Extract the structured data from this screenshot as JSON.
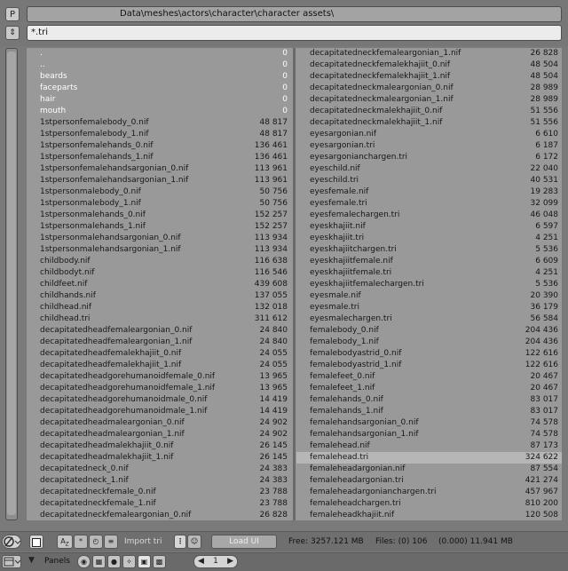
{
  "header": {
    "p_button_label": "P",
    "path": "Data\\meshes\\actors\\character\\character assets\\",
    "sort_button_label": "⇕",
    "filter": "*.tri"
  },
  "left_column": [
    {
      "name": ".",
      "size": "0",
      "type": "dir"
    },
    {
      "name": "..",
      "size": "0",
      "type": "dir"
    },
    {
      "name": "beards",
      "size": "0",
      "type": "dir"
    },
    {
      "name": "faceparts",
      "size": "0",
      "type": "dir"
    },
    {
      "name": "hair",
      "size": "0",
      "type": "dir"
    },
    {
      "name": "mouth",
      "size": "0",
      "type": "dir"
    },
    {
      "name": "1stpersonfemalebody_0.nif",
      "size": "48 817",
      "type": "file"
    },
    {
      "name": "1stpersonfemalebody_1.nif",
      "size": "48 817",
      "type": "file"
    },
    {
      "name": "1stpersonfemalehands_0.nif",
      "size": "136 461",
      "type": "file"
    },
    {
      "name": "1stpersonfemalehands_1.nif",
      "size": "136 461",
      "type": "file"
    },
    {
      "name": "1stpersonfemalehandsargonian_0.nif",
      "size": "113 961",
      "type": "file"
    },
    {
      "name": "1stpersonfemalehandsargonian_1.nif",
      "size": "113 961",
      "type": "file"
    },
    {
      "name": "1stpersonmalebody_0.nif",
      "size": "50 756",
      "type": "file"
    },
    {
      "name": "1stpersonmalebody_1.nif",
      "size": "50 756",
      "type": "file"
    },
    {
      "name": "1stpersonmalehands_0.nif",
      "size": "152 257",
      "type": "file"
    },
    {
      "name": "1stpersonmalehands_1.nif",
      "size": "152 257",
      "type": "file"
    },
    {
      "name": "1stpersonmalehandsargonian_0.nif",
      "size": "113 934",
      "type": "file"
    },
    {
      "name": "1stpersonmalehandsargonian_1.nif",
      "size": "113 934",
      "type": "file"
    },
    {
      "name": "childbody.nif",
      "size": "116 638",
      "type": "file"
    },
    {
      "name": "childbodyt.nif",
      "size": "116 546",
      "type": "file"
    },
    {
      "name": "childfeet.nif",
      "size": "439 608",
      "type": "file"
    },
    {
      "name": "childhands.nif",
      "size": "137 055",
      "type": "file"
    },
    {
      "name": "childhead.nif",
      "size": "132 018",
      "type": "file"
    },
    {
      "name": "childhead.tri",
      "size": "311 612",
      "type": "file"
    },
    {
      "name": "decapitatedheadfemaleargonian_0.nif",
      "size": "24 840",
      "type": "file"
    },
    {
      "name": "decapitatedheadfemaleargonian_1.nif",
      "size": "24 840",
      "type": "file"
    },
    {
      "name": "decapitatedheadfemalekhajiit_0.nif",
      "size": "24 055",
      "type": "file"
    },
    {
      "name": "decapitatedheadfemalekhajiit_1.nif",
      "size": "24 055",
      "type": "file"
    },
    {
      "name": "decapitatedheadgorehumanoidfemale_0.nif",
      "size": "13 965",
      "type": "file"
    },
    {
      "name": "decapitatedheadgorehumanoidfemale_1.nif",
      "size": "13 965",
      "type": "file"
    },
    {
      "name": "decapitatedheadgorehumanoidmale_0.nif",
      "size": "14 419",
      "type": "file"
    },
    {
      "name": "decapitatedheadgorehumanoidmale_1.nif",
      "size": "14 419",
      "type": "file"
    },
    {
      "name": "decapitatedheadmaleargonian_0.nif",
      "size": "24 902",
      "type": "file"
    },
    {
      "name": "decapitatedheadmaleargonian_1.nif",
      "size": "24 902",
      "type": "file"
    },
    {
      "name": "decapitatedheadmalekhajiit_0.nif",
      "size": "26 145",
      "type": "file"
    },
    {
      "name": "decapitatedheadmalekhajiit_1.nif",
      "size": "26 145",
      "type": "file"
    },
    {
      "name": "decapitatedneck_0.nif",
      "size": "24 383",
      "type": "file"
    },
    {
      "name": "decapitatedneck_1.nif",
      "size": "24 383",
      "type": "file"
    },
    {
      "name": "decapitatedneckfemale_0.nif",
      "size": "23 788",
      "type": "file"
    },
    {
      "name": "decapitatedneckfemale_1.nif",
      "size": "23 788",
      "type": "file"
    },
    {
      "name": "decapitatedneckfemaleargonian_0.nif",
      "size": "26 828",
      "type": "file"
    }
  ],
  "right_column": [
    {
      "name": "decapitatedneckfemaleargonian_1.nif",
      "size": "26 828",
      "type": "file"
    },
    {
      "name": "decapitatedneckfemalekhajiit_0.nif",
      "size": "48 504",
      "type": "file"
    },
    {
      "name": "decapitatedneckfemalekhajiit_1.nif",
      "size": "48 504",
      "type": "file"
    },
    {
      "name": "decapitatedneckmaleargonian_0.nif",
      "size": "28 989",
      "type": "file"
    },
    {
      "name": "decapitatedneckmaleargonian_1.nif",
      "size": "28 989",
      "type": "file"
    },
    {
      "name": "decapitatedneckmalekhajiit_0.nif",
      "size": "51 556",
      "type": "file"
    },
    {
      "name": "decapitatedneckmalekhajiit_1.nif",
      "size": "51 556",
      "type": "file"
    },
    {
      "name": "eyesargonian.nif",
      "size": "6 610",
      "type": "file"
    },
    {
      "name": "eyesargonian.tri",
      "size": "6 187",
      "type": "file"
    },
    {
      "name": "eyesargonianchargen.tri",
      "size": "6 172",
      "type": "file"
    },
    {
      "name": "eyeschild.nif",
      "size": "22 040",
      "type": "file"
    },
    {
      "name": "eyeschild.tri",
      "size": "40 531",
      "type": "file"
    },
    {
      "name": "eyesfemale.nif",
      "size": "19 283",
      "type": "file"
    },
    {
      "name": "eyesfemale.tri",
      "size": "32 099",
      "type": "file"
    },
    {
      "name": "eyesfemalechargen.tri",
      "size": "46 048",
      "type": "file"
    },
    {
      "name": "eyeskhajiit.nif",
      "size": "6 597",
      "type": "file"
    },
    {
      "name": "eyeskhajiit.tri",
      "size": "4 251",
      "type": "file"
    },
    {
      "name": "eyeskhajiitchargen.tri",
      "size": "5 536",
      "type": "file"
    },
    {
      "name": "eyeskhajiitfemale.nif",
      "size": "6 609",
      "type": "file"
    },
    {
      "name": "eyeskhajiitfemale.tri",
      "size": "4 251",
      "type": "file"
    },
    {
      "name": "eyeskhajiitfemalechargen.tri",
      "size": "5 536",
      "type": "file"
    },
    {
      "name": "eyesmale.nif",
      "size": "20 390",
      "type": "file"
    },
    {
      "name": "eyesmale.tri",
      "size": "36 179",
      "type": "file"
    },
    {
      "name": "eyesmalechargen.tri",
      "size": "56 584",
      "type": "file"
    },
    {
      "name": "femalebody_0.nif",
      "size": "204 436",
      "type": "file"
    },
    {
      "name": "femalebody_1.nif",
      "size": "204 436",
      "type": "file"
    },
    {
      "name": "femalebodyastrid_0.nif",
      "size": "122 616",
      "type": "file"
    },
    {
      "name": "femalebodyastrid_1.nif",
      "size": "122 616",
      "type": "file"
    },
    {
      "name": "femalefeet_0.nif",
      "size": "20 467",
      "type": "file"
    },
    {
      "name": "femalefeet_1.nif",
      "size": "20 467",
      "type": "file"
    },
    {
      "name": "femalehands_0.nif",
      "size": "83 017",
      "type": "file"
    },
    {
      "name": "femalehands_1.nif",
      "size": "83 017",
      "type": "file"
    },
    {
      "name": "femalehandsargonian_0.nif",
      "size": "74 578",
      "type": "file"
    },
    {
      "name": "femalehandsargonian_1.nif",
      "size": "74 578",
      "type": "file"
    },
    {
      "name": "femalehead.nif",
      "size": "87 173",
      "type": "file"
    },
    {
      "name": "femalehead.tri",
      "size": "324 622",
      "type": "file",
      "selected": true
    },
    {
      "name": "femaleheadargonian.nif",
      "size": "87 554",
      "type": "file"
    },
    {
      "name": "femaleheadargonian.tri",
      "size": "421 274",
      "type": "file"
    },
    {
      "name": "femaleheadargonianchargen.tri",
      "size": "457 967",
      "type": "file"
    },
    {
      "name": "femaleheadchargen.tri",
      "size": "810 200",
      "type": "file"
    },
    {
      "name": "femaleheadkhajiit.nif",
      "size": "120 508",
      "type": "file"
    }
  ],
  "footer": {
    "import_label": "Import tri",
    "load_label": "Load UI",
    "free_text": "Free: 3257.121 MB",
    "files_text": "Files: (0) 106",
    "size_text": "(0.000) 11.941 MB"
  },
  "panels": {
    "label": "Panels",
    "page_value": "1"
  }
}
